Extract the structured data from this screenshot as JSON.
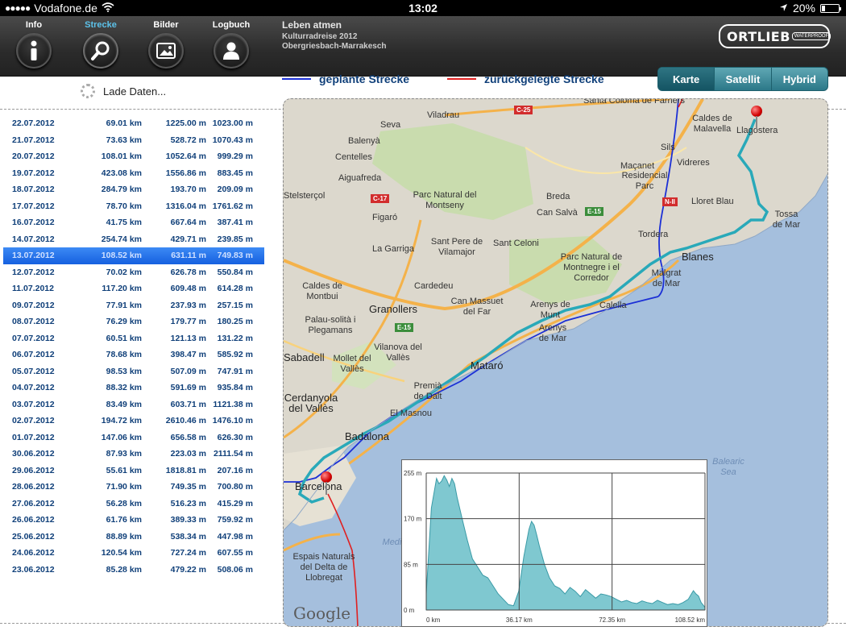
{
  "status_bar": {
    "carrier": "Vodafone.de",
    "time": "13:02",
    "battery_text": "20%",
    "battery_level": 0.2
  },
  "nav": {
    "items": [
      {
        "label": "Info",
        "icon": "info-icon",
        "active": false
      },
      {
        "label": "Strecke",
        "icon": "search-icon",
        "active": true
      },
      {
        "label": "Bilder",
        "icon": "photo-icon",
        "active": false
      },
      {
        "label": "Logbuch",
        "icon": "person-icon",
        "active": false
      }
    ],
    "project_title": "Leben atmen",
    "project_subtitle": "Kulturradreise 2012",
    "project_route": "Obergriesbach-Marrakesch",
    "logo_text": "ORTLIEB",
    "logo_badge": "WATERPROOF"
  },
  "loading_text": "Lade Daten...",
  "legend": {
    "planned": "geplante Strecke",
    "planned_color": "#1b2fd6",
    "traveled": "zurückgelegte Strecke",
    "traveled_color": "#e02020"
  },
  "map_type": {
    "options": [
      "Karte",
      "Satellit",
      "Hybrid"
    ],
    "selected": "Karte"
  },
  "stages": [
    {
      "date": "22.07.2012",
      "distance": "69.01 km",
      "ascent": "1225.00 m",
      "descent": "1023.00 m"
    },
    {
      "date": "21.07.2012",
      "distance": "73.63 km",
      "ascent": "528.72 m",
      "descent": "1070.43 m"
    },
    {
      "date": "20.07.2012",
      "distance": "108.01 km",
      "ascent": "1052.64 m",
      "descent": "999.29 m"
    },
    {
      "date": "19.07.2012",
      "distance": "423.08 km",
      "ascent": "1556.86 m",
      "descent": "883.45 m"
    },
    {
      "date": "18.07.2012",
      "distance": "284.79 km",
      "ascent": "193.70 m",
      "descent": "209.09 m"
    },
    {
      "date": "17.07.2012",
      "distance": "78.70 km",
      "ascent": "1316.04 m",
      "descent": "1761.62 m"
    },
    {
      "date": "16.07.2012",
      "distance": "41.75 km",
      "ascent": "667.64 m",
      "descent": "387.41 m"
    },
    {
      "date": "14.07.2012",
      "distance": "254.74 km",
      "ascent": "429.71 m",
      "descent": "239.85 m"
    },
    {
      "date": "13.07.2012",
      "distance": "108.52 km",
      "ascent": "631.11 m",
      "descent": "749.83 m"
    },
    {
      "date": "12.07.2012",
      "distance": "70.02 km",
      "ascent": "626.78 m",
      "descent": "550.84 m"
    },
    {
      "date": "11.07.2012",
      "distance": "117.20 km",
      "ascent": "609.48 m",
      "descent": "614.28 m"
    },
    {
      "date": "09.07.2012",
      "distance": "77.91 km",
      "ascent": "237.93 m",
      "descent": "257.15 m"
    },
    {
      "date": "08.07.2012",
      "distance": "76.29 km",
      "ascent": "179.77 m",
      "descent": "180.25 m"
    },
    {
      "date": "07.07.2012",
      "distance": "60.51 km",
      "ascent": "121.13 m",
      "descent": "131.22 m"
    },
    {
      "date": "06.07.2012",
      "distance": "78.68 km",
      "ascent": "398.47 m",
      "descent": "585.92 m"
    },
    {
      "date": "05.07.2012",
      "distance": "98.53 km",
      "ascent": "507.09 m",
      "descent": "747.91 m"
    },
    {
      "date": "04.07.2012",
      "distance": "88.32 km",
      "ascent": "591.69 m",
      "descent": "935.84 m"
    },
    {
      "date": "03.07.2012",
      "distance": "83.49 km",
      "ascent": "603.71 m",
      "descent": "1121.38 m"
    },
    {
      "date": "02.07.2012",
      "distance": "194.72 km",
      "ascent": "2610.46 m",
      "descent": "1476.10 m"
    },
    {
      "date": "01.07.2012",
      "distance": "147.06 km",
      "ascent": "656.58 m",
      "descent": "626.30 m"
    },
    {
      "date": "30.06.2012",
      "distance": "87.93 km",
      "ascent": "223.03 m",
      "descent": "2111.54 m"
    },
    {
      "date": "29.06.2012",
      "distance": "55.61 km",
      "ascent": "1818.81 m",
      "descent": "207.16 m"
    },
    {
      "date": "28.06.2012",
      "distance": "71.90 km",
      "ascent": "749.35 m",
      "descent": "700.80 m"
    },
    {
      "date": "27.06.2012",
      "distance": "56.28 km",
      "ascent": "516.23 m",
      "descent": "415.29 m"
    },
    {
      "date": "26.06.2012",
      "distance": "61.76 km",
      "ascent": "389.33 m",
      "descent": "759.92 m"
    },
    {
      "date": "25.06.2012",
      "distance": "88.89 km",
      "ascent": "538.34 m",
      "descent": "447.98 m"
    },
    {
      "date": "24.06.2012",
      "distance": "120.54 km",
      "ascent": "727.24 m",
      "descent": "607.55 m"
    },
    {
      "date": "23.06.2012",
      "distance": "85.28 km",
      "ascent": "479.22 m",
      "descent": "508.06 m"
    }
  ],
  "selected_stage": 8,
  "map": {
    "places": [
      "Viladrau",
      "Seva",
      "Santa Coloma de Farners",
      "Caldes de Malavella",
      "Llagostera",
      "Balenyà",
      "Sils",
      "Vidreres",
      "Centelles",
      "Maçanet",
      "Residencial Parc",
      "Aiguafreda",
      "Parc Natural del Montseny",
      "Breda",
      "Lloret Blau",
      "Figaró",
      "Can Salvà",
      "Tossa de Mar",
      "La Garriga",
      "Sant Pere de Vilamajor",
      "Sant Celoni",
      "Parc Natural de Montnegre i el Corredor",
      "Tordera",
      "Blanes",
      "Malgrat de Mar",
      "Caldes de Montbui",
      "Cardedeu",
      "Granollers",
      "Can Massuet del Far",
      "Arenys de Munt",
      "Calella",
      "Palau-solità i Plegamans",
      "Arenys de Mar",
      "Sabadell",
      "Mollet del Vallès",
      "Vilanova del Vallès",
      "Mataró",
      "Premià de Dalt",
      "Cerdanyola del Vallès",
      "El Masnou",
      "Badalona",
      "Barcelona",
      "Espais Naturals del Delta de Llobregat",
      "Balearic Sea",
      "Mediterranean Sea",
      "Stelsterçol"
    ],
    "road_signs": [
      "C-25",
      "C-17",
      "E-15",
      "N-II"
    ],
    "attribution": "Google"
  },
  "chart_data": {
    "type": "area",
    "title": "",
    "xlabel": "",
    "ylabel": "",
    "x_ticks": [
      "0 km",
      "36.17 km",
      "72.35 km",
      "108.52 km"
    ],
    "y_ticks": [
      "0 m",
      "85 m",
      "170 m",
      "255 m"
    ],
    "xlim": [
      0,
      108.52
    ],
    "ylim": [
      0,
      255
    ],
    "grid": true,
    "x": [
      0,
      2,
      4,
      5,
      6,
      7,
      8,
      9,
      10,
      11,
      12,
      14,
      16,
      18,
      20,
      22,
      24,
      26,
      28,
      30,
      32,
      34,
      36,
      38,
      40,
      41,
      42,
      43,
      44,
      46,
      48,
      50,
      52,
      54,
      56,
      58,
      60,
      62,
      64,
      66,
      68,
      70,
      72,
      74,
      76,
      78,
      80,
      82,
      84,
      86,
      88,
      90,
      92,
      94,
      96,
      98,
      100,
      102,
      103,
      104,
      105,
      106,
      107,
      108.52
    ],
    "series": [
      {
        "values": [
          30,
          190,
          245,
          235,
          240,
          250,
          242,
          230,
          245,
          235,
          210,
          170,
          130,
          95,
          80,
          65,
          60,
          45,
          30,
          20,
          10,
          8,
          35,
          100,
          150,
          165,
          158,
          140,
          120,
          85,
          60,
          45,
          40,
          30,
          42,
          35,
          25,
          38,
          30,
          22,
          30,
          28,
          25,
          20,
          15,
          18,
          14,
          12,
          17,
          14,
          12,
          18,
          14,
          10,
          12,
          10,
          14,
          20,
          28,
          36,
          30,
          26,
          14,
          5
        ]
      }
    ]
  }
}
